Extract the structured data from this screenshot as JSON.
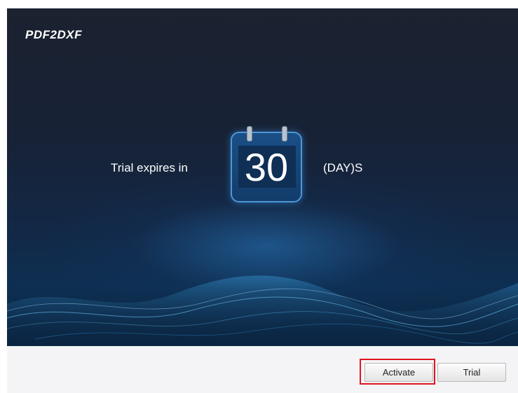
{
  "app": {
    "title": "PDF2DXF"
  },
  "trial": {
    "prefix": "Trial expires in",
    "days": "30",
    "suffix": "(DAY)S"
  },
  "buttons": {
    "activate_label": "Activate",
    "trial_label": "Trial"
  },
  "colors": {
    "hero_top": "#1b2230",
    "hero_bottom": "#0e2f52",
    "calendar_fill": "#1a4f86",
    "calendar_border": "#4e97d6",
    "highlight_border": "#e0141d"
  },
  "icons": {
    "calendar": "calendar-icon"
  }
}
